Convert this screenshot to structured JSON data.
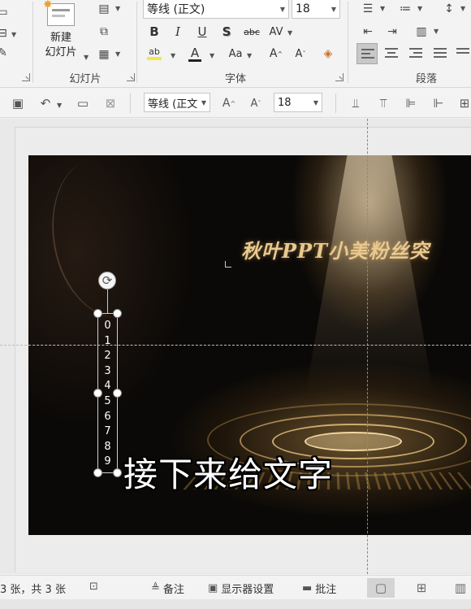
{
  "ribbon": {
    "slides_group": {
      "label": "幻灯片",
      "new_slide_line1": "新建",
      "new_slide_line2": "幻灯片"
    },
    "font_group": {
      "label": "字体",
      "font_name": "等线 (正文)",
      "font_size": "18"
    },
    "paragraph_group": {
      "label": "段落"
    }
  },
  "qat": {
    "font_name": "等线 (正文",
    "font_size": "18"
  },
  "slide": {
    "title": "秋叶PPT小美粉丝突",
    "textbox_digits": [
      "0",
      "1",
      "2",
      "3",
      "4",
      "5",
      "6",
      "7",
      "8",
      "9"
    ],
    "subtitle": "接下来给文字"
  },
  "statusbar": {
    "slide_count": "3 张，共 3 张",
    "notes_label": "备注",
    "display_settings_label": "显示器设置",
    "comments_label": "批注"
  },
  "colors": {
    "accent_gold": "#e8c98e",
    "ribbon_bg": "#f3f3f3",
    "slide_bg": "#0b0907"
  }
}
